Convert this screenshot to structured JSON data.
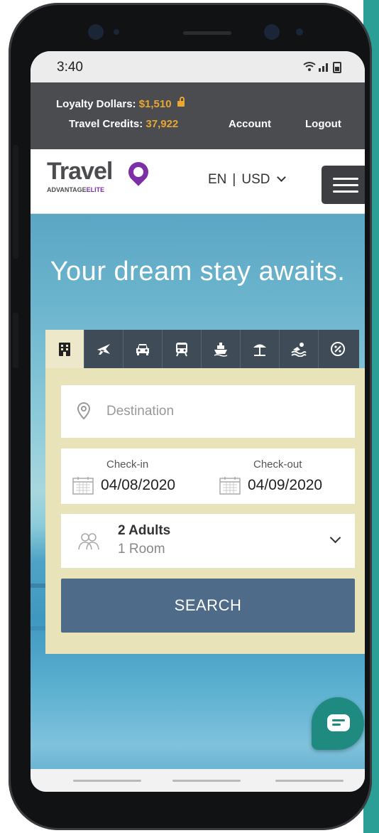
{
  "status_bar": {
    "time": "3:40",
    "icons": "wifi-icon signal-icon battery-icon"
  },
  "loyalty": {
    "dollars_label": "Loyalty Dollars:",
    "dollars_value": "$1,510",
    "credits_label": "Travel Credits:",
    "credits_value": "37,922",
    "account": "Account",
    "logout": "Logout"
  },
  "header": {
    "logo_text": "Travel",
    "logo_sub": "ADVANTAGE",
    "logo_elite": "ELITE",
    "language": "EN",
    "separator": "|",
    "currency": "USD"
  },
  "hero": {
    "title": "Your dream stay awaits."
  },
  "tabs": [
    {
      "name": "hotel-icon",
      "active": true
    },
    {
      "name": "flight-icon",
      "active": false
    },
    {
      "name": "car-icon",
      "active": false
    },
    {
      "name": "train-icon",
      "active": false
    },
    {
      "name": "cruise-icon",
      "active": false
    },
    {
      "name": "beach-umbrella-icon",
      "active": false
    },
    {
      "name": "swimming-icon",
      "active": false
    },
    {
      "name": "discount-icon",
      "active": false
    }
  ],
  "search_form": {
    "destination_placeholder": "Destination",
    "checkin_label": "Check-in",
    "checkin_value": "04/08/2020",
    "checkout_label": "Check-out",
    "checkout_value": "04/09/2020",
    "guests_adults": "2 Adults",
    "guests_rooms": "1 Room",
    "search_label": "SEARCH"
  },
  "colors": {
    "accent_gold": "#e8a733",
    "brand_purple": "#7d2fa8",
    "search_button": "#4e6b89",
    "chat_button": "#1f8b80",
    "loyalty_bar": "#4a4c50",
    "form_panel": "#e8e3b8"
  }
}
